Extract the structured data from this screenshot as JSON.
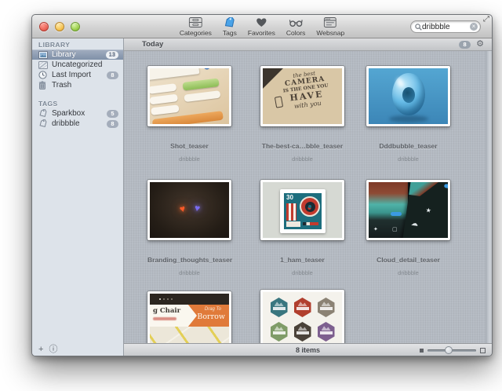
{
  "window": {
    "toolbar": {
      "items": [
        {
          "label": "Categories"
        },
        {
          "label": "Tags"
        },
        {
          "label": "Favorites"
        },
        {
          "label": "Colors"
        },
        {
          "label": "Websnap"
        }
      ],
      "active_item": "Tags",
      "search": {
        "value": "dribbble"
      }
    },
    "sidebar": {
      "sections": [
        {
          "title": "LIBRARY",
          "items": [
            {
              "label": "Library",
              "badge": "13"
            },
            {
              "label": "Uncategorized",
              "badge": ""
            },
            {
              "label": "Last Import",
              "badge": "8"
            },
            {
              "label": "Trash",
              "badge": ""
            }
          ]
        },
        {
          "title": "TAGS",
          "items": [
            {
              "label": "Sparkbox",
              "badge": "5"
            },
            {
              "label": "dribbble",
              "badge": "8"
            }
          ]
        }
      ]
    },
    "content": {
      "group": {
        "title": "Today",
        "badge": "8"
      },
      "items": [
        {
          "title": "Shot_teaser",
          "tag": "dribbble"
        },
        {
          "title": "The-best-ca…bble_teaser",
          "tag": "dribbble",
          "art_lines": {
            "l1": "the best",
            "l2": "CAMERA",
            "l3": "IS THE ONE YOU",
            "l4": "HAVE",
            "l5": "with you"
          }
        },
        {
          "title": "Dddbubble_teaser",
          "tag": "dribbble"
        },
        {
          "title": "Branding_thoughts_teaser",
          "tag": "dribbble"
        },
        {
          "title": "1_ham_teaser",
          "tag": "dribbble",
          "art_stamp": {
            "value": "30"
          }
        },
        {
          "title": "Cloud_detail_teaser",
          "tag": "dribbble"
        },
        {
          "title": "",
          "tag": "",
          "art_ribbon": {
            "name": "g Chair",
            "action_small": "Drag To",
            "action_big": "Borrow"
          }
        },
        {
          "title": "",
          "tag": ""
        }
      ],
      "status": {
        "count": "8 items"
      }
    },
    "colors": {
      "accent_blue": "#3b9ae1",
      "selection": "#8b99ad",
      "content_bg": "#b4bac2",
      "sidebar_bg": "#dde3ea"
    }
  }
}
